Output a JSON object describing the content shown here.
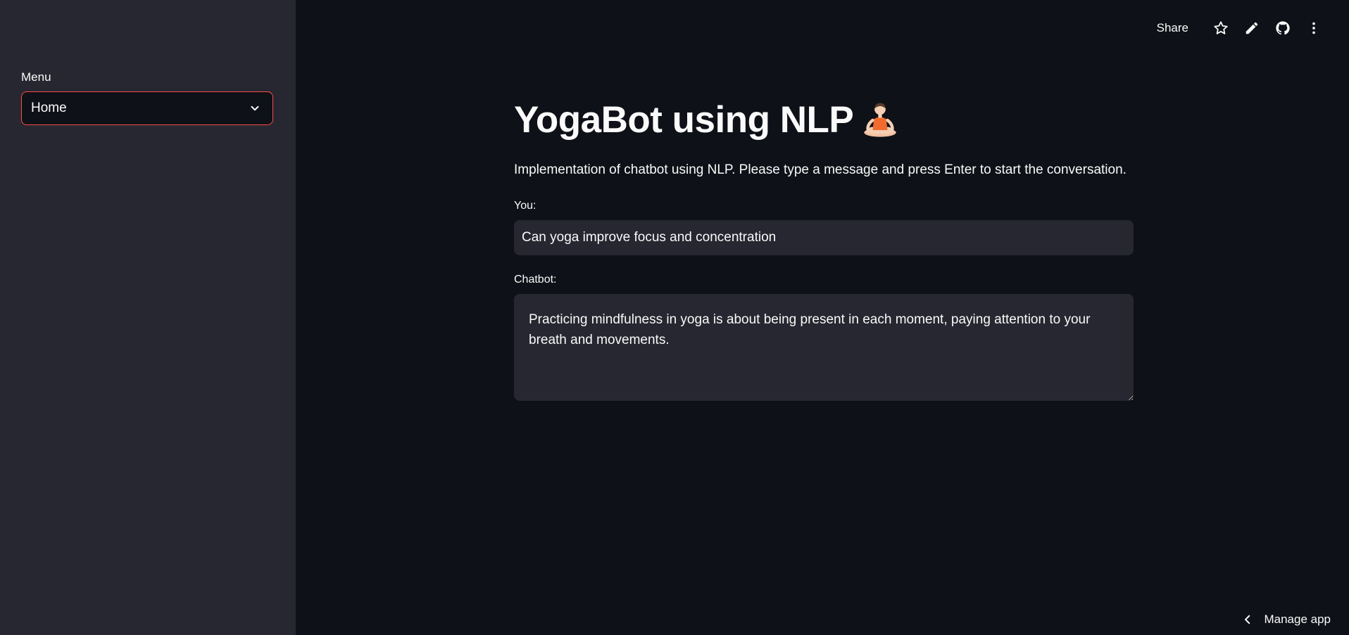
{
  "sidebar": {
    "menu_label": "Menu",
    "select": {
      "value": "Home",
      "icon": "chevron-down-icon"
    }
  },
  "toolbar": {
    "share_label": "Share",
    "icons": [
      "star-icon",
      "pencil-icon",
      "github-icon",
      "kebab-menu-icon"
    ]
  },
  "main": {
    "title": "YogaBot using NLP",
    "title_icon": "person-in-lotus-position-icon",
    "subtitle": "Implementation of chatbot using NLP. Please type a message and press Enter to start the conversation.",
    "you_label": "You:",
    "you_value": "Can yoga improve focus and concentration",
    "chatbot_label": "Chatbot:",
    "chatbot_value": "Practicing mindfulness in yoga is about being present in each moment, paying attention to your breath and movements."
  },
  "footer": {
    "manage_label": "Manage app"
  },
  "colors": {
    "background": "#0e1117",
    "sidebar": "#262730",
    "accent": "#ff4b4b",
    "input_bg": "#262730",
    "text": "#fafafa"
  }
}
